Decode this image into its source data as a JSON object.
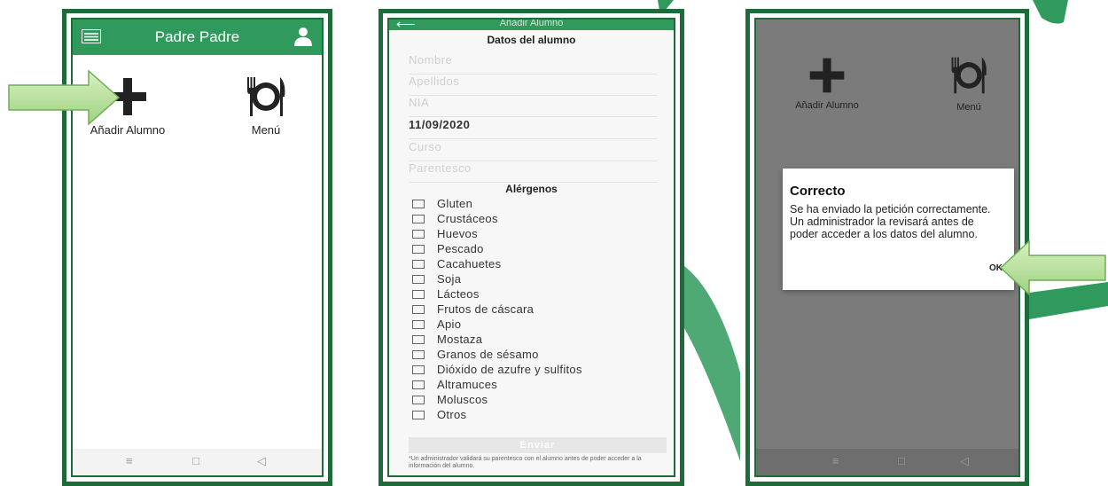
{
  "colors": {
    "brand_green": "#2f9a5c",
    "frame_green": "#1e6b3a",
    "dim_overlay": "#7b7b7b",
    "arrow_green": "#b8e0a0"
  },
  "screen1": {
    "title": "Padre Padre",
    "icons": {
      "menu": "list-icon",
      "user": "person-icon"
    },
    "tiles": [
      {
        "label": "Añadir Alumno",
        "icon": "plus-icon"
      },
      {
        "label": "Menú",
        "icon": "plate-cutlery-icon"
      }
    ],
    "nav": {
      "menu": "≡",
      "home": "□",
      "back": "◁"
    }
  },
  "screen2": {
    "title": "Añadir Alumno",
    "section_title": "Datos del alumno",
    "fields": [
      {
        "placeholder": "Nombre",
        "value": ""
      },
      {
        "placeholder": "Apellidos",
        "value": ""
      },
      {
        "placeholder": "NIA",
        "value": ""
      },
      {
        "placeholder": "",
        "value": "11/09/2020"
      },
      {
        "placeholder": "Curso",
        "value": ""
      },
      {
        "placeholder": "Parentesco",
        "value": ""
      }
    ],
    "allergens_title": "Alérgenos",
    "allergens": [
      "Gluten",
      "Crustáceos",
      "Huevos",
      "Pescado",
      "Cacahuetes",
      "Soja",
      "Lácteos",
      "Frutos de cáscara",
      "Apio",
      "Mostaza",
      "Granos de sésamo",
      "Dióxido de azufre y sulfitos",
      "Altramuces",
      "Moluscos",
      "Otros"
    ],
    "submit": "Enviar",
    "note": "*Un administrador validará su parentesco con el alumno antes de poder acceder a la información del alumno."
  },
  "screen3": {
    "tiles": [
      {
        "label": "Añadir Alumno",
        "icon": "plus-icon"
      },
      {
        "label": "Menú",
        "icon": "plate-cutlery-icon"
      }
    ],
    "dialog": {
      "title": "Correcto",
      "message": "Se ha enviado la petición correctamente. Un administrador la revisará antes de poder acceder a los datos del alumno.",
      "ok": "OK"
    },
    "nav": {
      "menu": "≡",
      "home": "□",
      "back": "◁"
    }
  }
}
